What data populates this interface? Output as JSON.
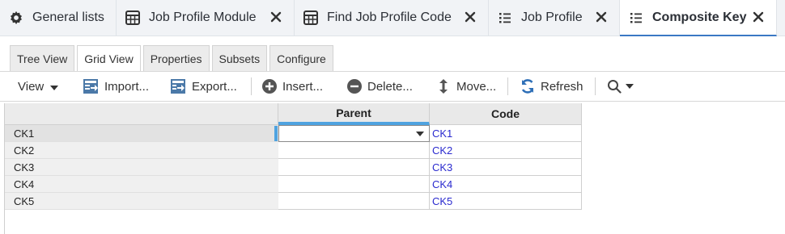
{
  "tabs": [
    {
      "label": "General lists",
      "icon": "gear-icon",
      "active": false,
      "closable": false
    },
    {
      "label": "Job Profile Module",
      "icon": "table-icon",
      "active": false,
      "closable": true
    },
    {
      "label": "Find Job Profile Code",
      "icon": "table-icon",
      "active": false,
      "closable": true
    },
    {
      "label": "Job Profile",
      "icon": "list-icon",
      "active": false,
      "closable": true
    },
    {
      "label": "Composite Key",
      "icon": "list-icon",
      "active": true,
      "closable": true
    }
  ],
  "subtabs": [
    "Tree View",
    "Grid View",
    "Properties",
    "Subsets",
    "Configure"
  ],
  "active_subtab": "Grid View",
  "toolbar": {
    "view_label": "View",
    "import_label": "Import...",
    "export_label": "Export...",
    "insert_label": "Insert...",
    "delete_label": "Delete...",
    "move_label": "Move...",
    "refresh_label": "Refresh"
  },
  "grid": {
    "columns": [
      "Parent",
      "Code"
    ],
    "rows": [
      {
        "label": "CK1",
        "parent": "",
        "code": "CK1"
      },
      {
        "label": "CK2",
        "parent": "",
        "code": "CK2"
      },
      {
        "label": "CK3",
        "parent": "",
        "code": "CK3"
      },
      {
        "label": "CK4",
        "parent": "",
        "code": "CK4"
      },
      {
        "label": "CK5",
        "parent": "",
        "code": "CK5"
      }
    ],
    "selected_row": "CK1"
  },
  "colors": {
    "accent": "#3b78c4",
    "selection": "#4fa3e0",
    "link": "#2b2bcf"
  }
}
